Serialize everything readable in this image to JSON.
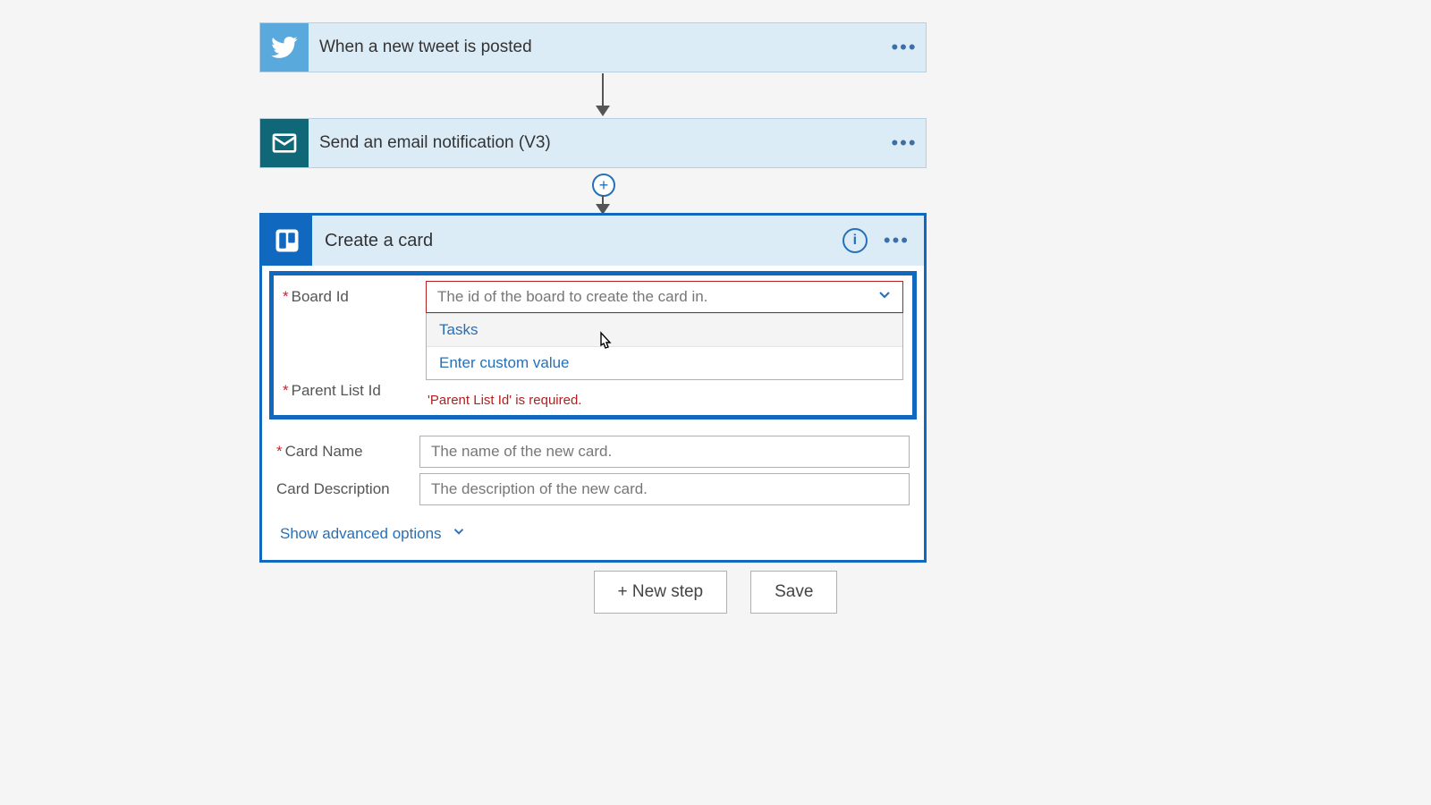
{
  "step1": {
    "title": "When a new tweet is posted"
  },
  "step2": {
    "title": "Send an email notification (V3)"
  },
  "expanded": {
    "title": "Create a card",
    "fields": {
      "board": {
        "label": "Board Id",
        "placeholder": "The id of the board to create the card in."
      },
      "board_options": {
        "option1": "Tasks",
        "custom": "Enter custom value"
      },
      "parent": {
        "label": "Parent List Id",
        "validation": "'Parent List Id' is required."
      },
      "cardname": {
        "label": "Card Name",
        "placeholder": "The name of the new card."
      },
      "carddesc": {
        "label": "Card Description",
        "placeholder": "The description of the new card."
      }
    },
    "advanced_label": "Show advanced options"
  },
  "footer": {
    "newstep": "+ New step",
    "save": "Save"
  },
  "required_marker": "*"
}
